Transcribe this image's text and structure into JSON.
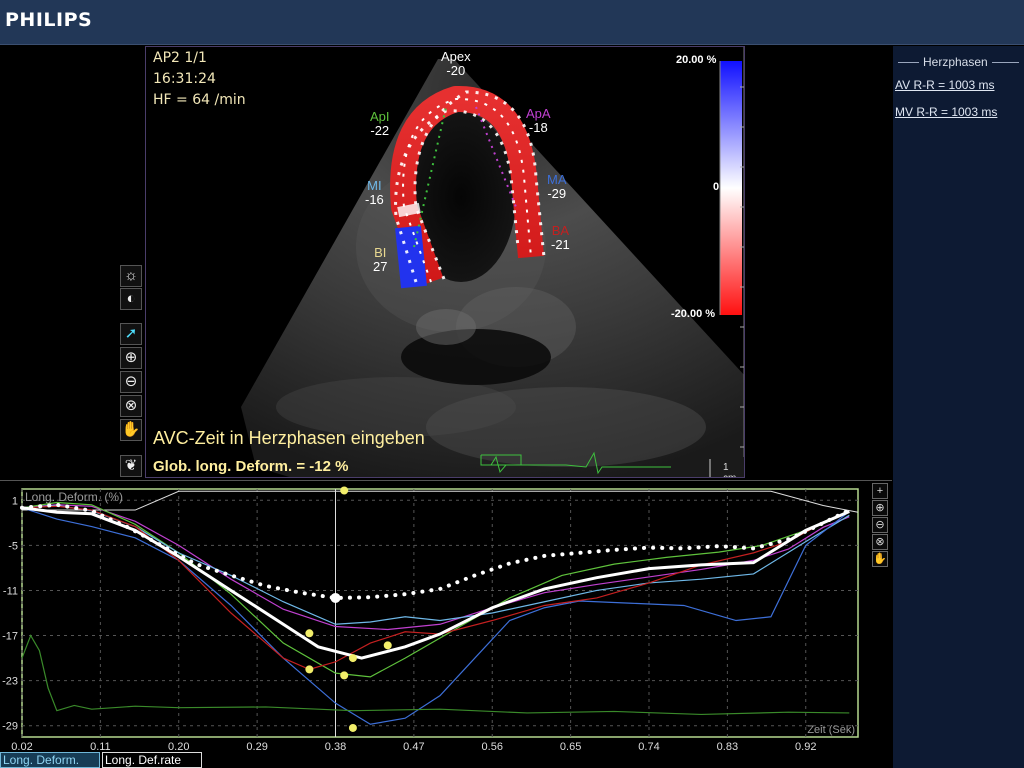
{
  "brand": "PHILIPS",
  "right_panel": {
    "title": "Herzphasen",
    "av_rr": "AV R-R = 1003 ms",
    "mv_rr": "MV R-R = 1003 ms"
  },
  "viewport": {
    "view_label": "AP2  1/1",
    "time": "16:31:24",
    "heart_rate": "HF = 64 /min",
    "message": "AVC-Zeit in Herzphasen eingeben",
    "global_strain": "Glob. long. Deform. = -12 %",
    "scale": "1 cm",
    "colorbar": {
      "top": "20.00 %",
      "mid": "0",
      "bottom": "-20.00 %"
    },
    "segments": [
      {
        "name": "Apex",
        "value": "-20",
        "color": "#ffffff"
      },
      {
        "name": "ApI",
        "value": "-22",
        "color": "#5fc23c"
      },
      {
        "name": "ApA",
        "value": "-18",
        "color": "#c040d0"
      },
      {
        "name": "MI",
        "value": "-16",
        "color": "#6fb8e8"
      },
      {
        "name": "MA",
        "value": "-29",
        "color": "#3d6fd8"
      },
      {
        "name": "BI",
        "value": "27",
        "color": "#e8d890"
      },
      {
        "name": "BA",
        "value": "-21",
        "color": "#c42020"
      }
    ]
  },
  "tools": {
    "left": [
      "brightness-icon",
      "contrast-icon",
      "pointer-icon",
      "zoom-in-icon",
      "zoom-out-icon",
      "zoom-reset-icon",
      "pan-hand-icon",
      "lung-icon"
    ],
    "chart": [
      "plus-icon",
      "zoom-in-icon",
      "zoom-out-icon",
      "zoom-reset-icon",
      "pan-hand-icon"
    ]
  },
  "tabs": {
    "deform": "Long. Deform.",
    "rate": "Long. Def.rate"
  },
  "chart_data": {
    "type": "line",
    "ylabel": "Long. Deform. (%)",
    "xlabel": "Zeit (Sek)",
    "x_ticks": [
      "0.02",
      "0.11",
      "0.20",
      "0.29",
      "0.38",
      "0.47",
      "0.56",
      "0.65",
      "0.74",
      "0.83",
      "0.92"
    ],
    "y_ticks": [
      "1",
      "-5",
      "-11",
      "-17",
      "-23",
      "-29"
    ],
    "xlim": [
      0.02,
      0.98
    ],
    "ylim": [
      -30.5,
      2.5
    ],
    "grid": true,
    "cursor_x": 0.38,
    "series": [
      {
        "color": "#c040d0",
        "x": [
          0.02,
          0.06,
          0.1,
          0.15,
          0.2,
          0.26,
          0.32,
          0.38,
          0.44,
          0.5,
          0.56,
          0.62,
          0.68,
          0.74,
          0.8,
          0.86,
          0.9,
          0.94,
          0.97
        ],
        "y": [
          0,
          0.4,
          0.2,
          -1.8,
          -5,
          -9.5,
          -13.5,
          -15.8,
          -16.2,
          -15.5,
          -13.3,
          -11.3,
          -10.2,
          -9.2,
          -8.2,
          -7,
          -5.5,
          -2.6,
          -1.2
        ]
      },
      {
        "color": "#5fc23c",
        "x": [
          0.02,
          0.06,
          0.1,
          0.15,
          0.2,
          0.26,
          0.32,
          0.38,
          0.42,
          0.46,
          0.52,
          0.58,
          0.64,
          0.7,
          0.76,
          0.82,
          0.87,
          0.92,
          0.97
        ],
        "y": [
          0,
          0.7,
          0.4,
          -2.2,
          -6,
          -11.5,
          -18,
          -22,
          -22.5,
          -20,
          -16,
          -12,
          -9,
          -7.5,
          -6.6,
          -5.9,
          -5,
          -3,
          -0.5
        ]
      },
      {
        "color": "#6fb8e8",
        "x": [
          0.02,
          0.06,
          0.1,
          0.15,
          0.2,
          0.26,
          0.32,
          0.38,
          0.42,
          0.46,
          0.5,
          0.56,
          0.62,
          0.68,
          0.74,
          0.8,
          0.86,
          0.92,
          0.97
        ],
        "y": [
          0,
          0.3,
          -0.4,
          -2.5,
          -6,
          -9,
          -12.5,
          -15.5,
          -15.2,
          -14.5,
          -15,
          -14,
          -12.5,
          -11,
          -10,
          -9.5,
          -8.8,
          -4.5,
          -1
        ]
      },
      {
        "color": "#3d6fd8",
        "x": [
          0.02,
          0.06,
          0.1,
          0.15,
          0.2,
          0.26,
          0.32,
          0.38,
          0.42,
          0.46,
          0.5,
          0.54,
          0.58,
          0.62,
          0.66,
          0.72,
          0.78,
          0.84,
          0.88,
          0.92,
          0.97
        ],
        "y": [
          0,
          -1.5,
          -2.5,
          -4,
          -7,
          -13,
          -20,
          -26,
          -28.8,
          -28,
          -25,
          -20,
          -15,
          -13.3,
          -12.4,
          -12.7,
          -13,
          -15,
          -14.5,
          -5,
          -0.5
        ]
      },
      {
        "color": "#c42020",
        "x": [
          0.02,
          0.06,
          0.1,
          0.15,
          0.2,
          0.26,
          0.32,
          0.35,
          0.38,
          0.42,
          0.46,
          0.5,
          0.56,
          0.62,
          0.68,
          0.74,
          0.8,
          0.86,
          0.9,
          0.94,
          0.97
        ],
        "y": [
          0,
          0.2,
          -0.3,
          -2.5,
          -7,
          -14,
          -20,
          -21.5,
          -20.5,
          -18,
          -16.5,
          -16.8,
          -15,
          -13,
          -12,
          -10,
          -7.6,
          -6,
          -4.5,
          -2,
          -0.5
        ]
      },
      {
        "color": "#ffffff",
        "x": [
          0.02,
          0.06,
          0.1,
          0.15,
          0.2,
          0.26,
          0.32,
          0.36,
          0.41,
          0.46,
          0.5,
          0.56,
          0.62,
          0.68,
          0.74,
          0.8,
          0.86,
          0.92,
          0.97
        ],
        "y": [
          0,
          -0.6,
          -0.8,
          -3,
          -6.5,
          -11,
          -15.5,
          -18.5,
          -20,
          -18.5,
          -16.8,
          -13.3,
          -10.8,
          -9.3,
          -8.1,
          -7.6,
          -7.3,
          -3,
          -0.5
        ]
      },
      {
        "color": "#3a8a2a",
        "x": [
          0.02,
          0.03,
          0.04,
          0.05,
          0.06,
          0.08,
          0.1,
          0.15,
          0.2,
          0.3,
          0.4,
          0.5,
          0.6,
          0.7,
          0.8,
          0.9,
          0.97
        ],
        "y": [
          -20,
          -17,
          -19,
          -24,
          -27,
          -26.3,
          -26.8,
          -26.4,
          -26.6,
          -26.5,
          -27,
          -26.8,
          -27.3,
          -27.1,
          -27.5,
          -27.2,
          -27.3
        ]
      },
      {
        "color": "#ffffff",
        "style": "dotted",
        "x": [
          0.02,
          0.06,
          0.1,
          0.14,
          0.18,
          0.22,
          0.26,
          0.3,
          0.34,
          0.38,
          0.42,
          0.46,
          0.5,
          0.54,
          0.58,
          0.62,
          0.66,
          0.7,
          0.74,
          0.78,
          0.82,
          0.86,
          0.9,
          0.93,
          0.97
        ],
        "y": [
          0,
          0.4,
          -0.4,
          -2.5,
          -5,
          -7.5,
          -9,
          -10.4,
          -11.3,
          -12,
          -11.9,
          -11.5,
          -10.8,
          -9,
          -7.4,
          -6.4,
          -6,
          -5.6,
          -5.3,
          -5.4,
          -5.1,
          -5.4,
          -4.2,
          -2.6,
          -0.3
        ]
      }
    ],
    "markers": [
      {
        "x": 0.35,
        "y": -16.7
      },
      {
        "x": 0.35,
        "y": -21.5
      },
      {
        "x": 0.39,
        "y": -22.3
      },
      {
        "x": 0.4,
        "y": -20
      },
      {
        "x": 0.44,
        "y": -18.3
      },
      {
        "x": 0.4,
        "y": -29.3
      },
      {
        "x": 0.39,
        "y": 2.3
      }
    ]
  }
}
